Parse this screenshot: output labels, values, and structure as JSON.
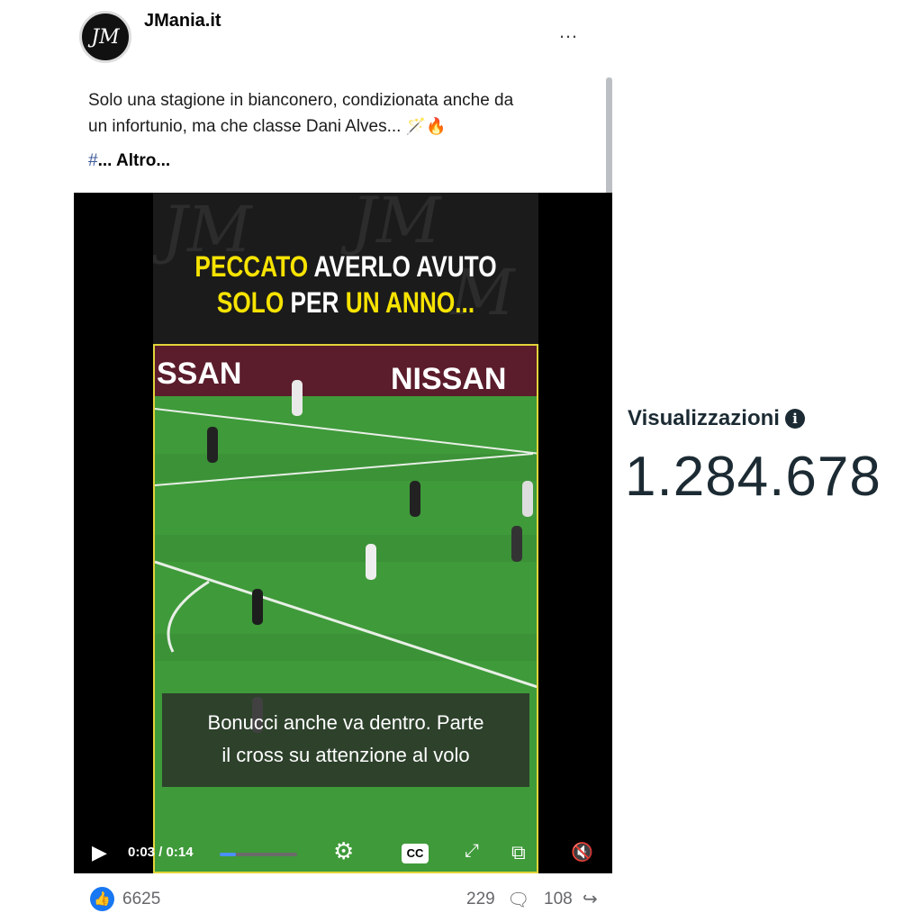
{
  "post": {
    "page_name": "JMania.it",
    "avatar_text": "JM",
    "more_icon": "…",
    "caption_line1": "Solo una stagione in bianconero, condizionata anche da",
    "caption_line2": "un infortunio, ma che classe Dani Alves...",
    "caption_emojis": "🪄🔥",
    "hashtag": "#",
    "more_link": "... Altro..."
  },
  "video": {
    "overlay_line1_a": "PECCATO",
    "overlay_line1_b": " AVERLO AVUTO",
    "overlay_line2_a": "SOLO",
    "overlay_line2_b": " PER ",
    "overlay_line2_c": "UN ANNO...",
    "board_left": "SSAN",
    "board_right": "NISSAN",
    "subtitle_line1": "Bonucci anche va dentro. Parte",
    "subtitle_line2": "il cross su attenzione al volo",
    "current_time": "0:03",
    "duration": "0:14",
    "time_separator": " / ",
    "progress_fraction": 0.21,
    "cc_label": "CC"
  },
  "reactions": {
    "likes": "6625",
    "comments": "229",
    "shares": "108"
  },
  "stats": {
    "views_label": "Visualizzazioni",
    "views_value": "1.284.678"
  },
  "colors": {
    "accent": "#1877f2",
    "overlay_yellow": "#f7e300",
    "pitch_green": "#3f9a3a"
  }
}
